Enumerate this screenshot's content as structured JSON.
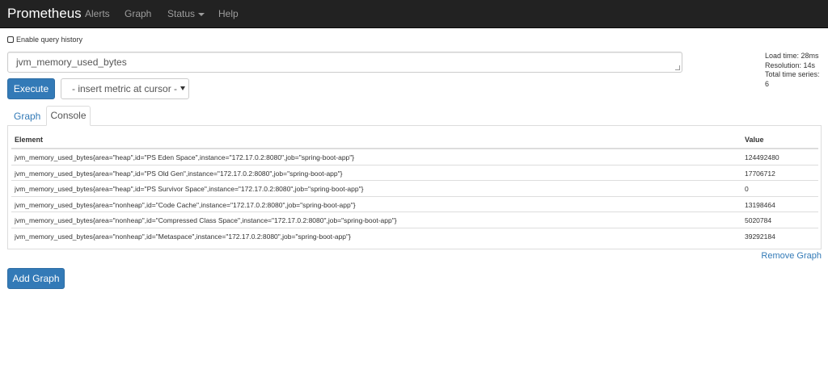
{
  "navbar": {
    "brand": "Prometheus",
    "links": [
      {
        "label": "Alerts"
      },
      {
        "label": "Graph"
      },
      {
        "label": "Status"
      },
      {
        "label": "Help"
      }
    ]
  },
  "query_history": {
    "label": "Enable query history",
    "checked": false
  },
  "query": {
    "value": "jvm_memory_used_bytes"
  },
  "stats": {
    "load_time": "Load time: 28ms",
    "resolution": "Resolution: 14s",
    "total_series": "Total time series: 6"
  },
  "execute_label": "Execute",
  "metric_select": {
    "selected": "- insert metric at cursor -"
  },
  "tabs": [
    {
      "label": "Graph",
      "active": false
    },
    {
      "label": "Console",
      "active": true
    }
  ],
  "table": {
    "columns": [
      "Element",
      "Value"
    ],
    "rows": [
      {
        "element": "jvm_memory_used_bytes{area=\"heap\",id=\"PS Eden Space\",instance=\"172.17.0.2:8080\",job=\"spring-boot-app\"}",
        "value": "124492480"
      },
      {
        "element": "jvm_memory_used_bytes{area=\"heap\",id=\"PS Old Gen\",instance=\"172.17.0.2:8080\",job=\"spring-boot-app\"}",
        "value": "17706712"
      },
      {
        "element": "jvm_memory_used_bytes{area=\"heap\",id=\"PS Survivor Space\",instance=\"172.17.0.2:8080\",job=\"spring-boot-app\"}",
        "value": "0"
      },
      {
        "element": "jvm_memory_used_bytes{area=\"nonheap\",id=\"Code Cache\",instance=\"172.17.0.2:8080\",job=\"spring-boot-app\"}",
        "value": "13198464"
      },
      {
        "element": "jvm_memory_used_bytes{area=\"nonheap\",id=\"Compressed Class Space\",instance=\"172.17.0.2:8080\",job=\"spring-boot-app\"}",
        "value": "5020784"
      },
      {
        "element": "jvm_memory_used_bytes{area=\"nonheap\",id=\"Metaspace\",instance=\"172.17.0.2:8080\",job=\"spring-boot-app\"}",
        "value": "39292184"
      }
    ]
  },
  "remove_graph_label": "Remove Graph",
  "add_graph_label": "Add Graph",
  "colors": {
    "navbar": "#222222",
    "primary": "#337ab7",
    "link": "#337ab7"
  }
}
